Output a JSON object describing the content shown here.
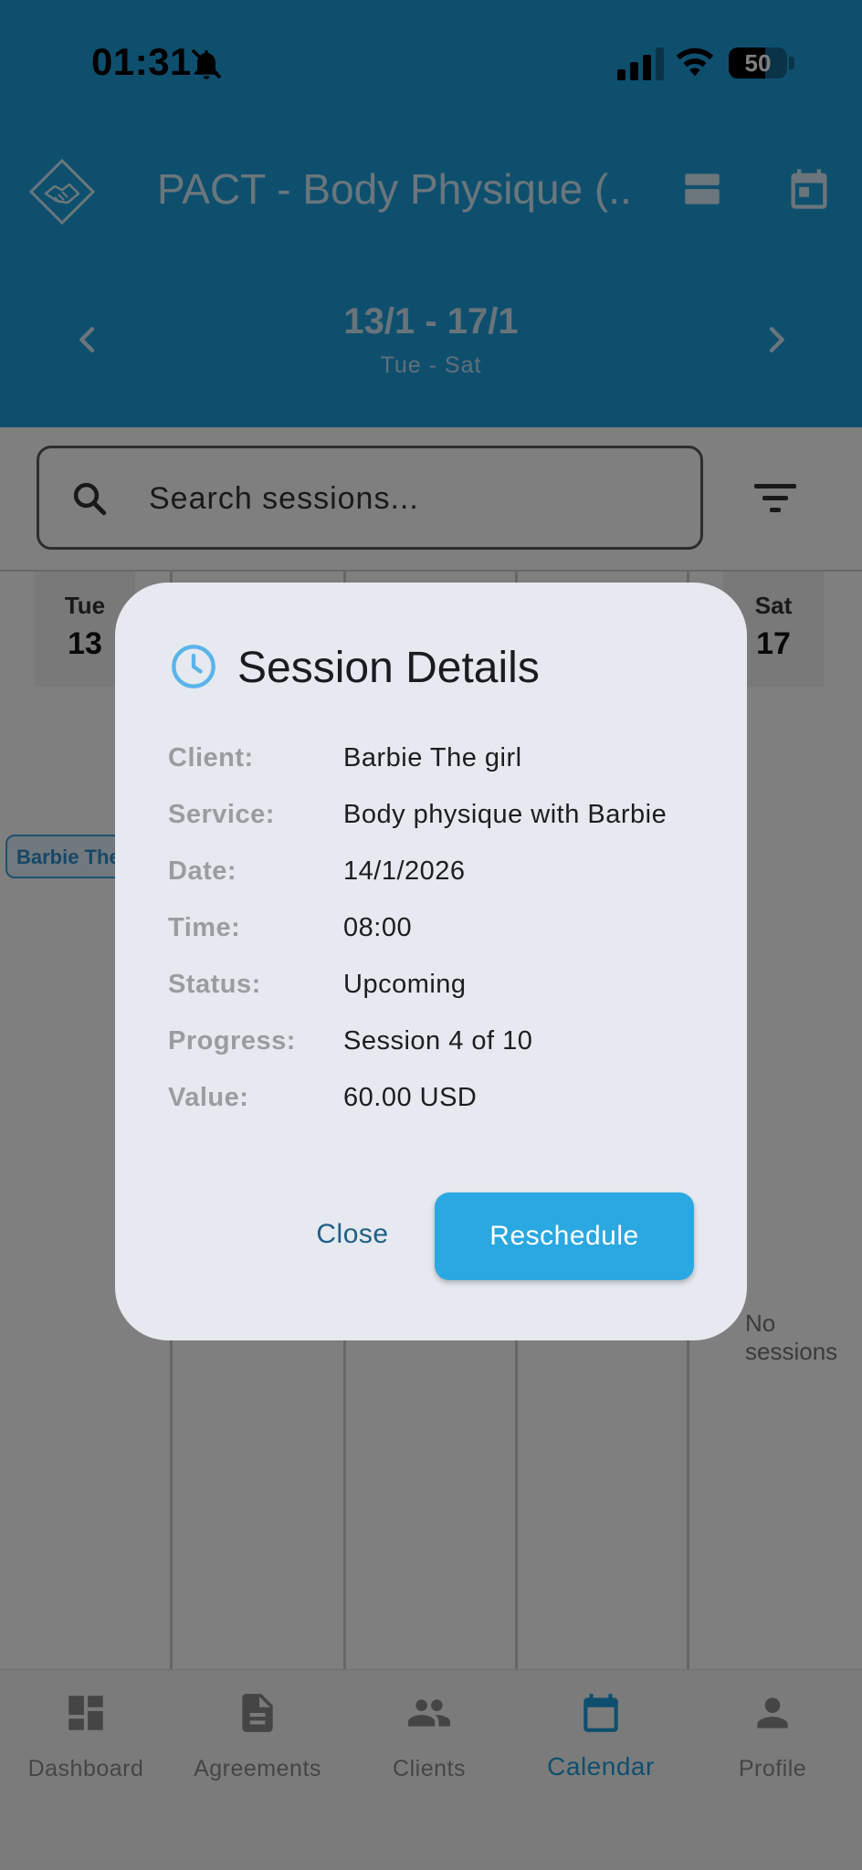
{
  "status_bar": {
    "time": "01:31",
    "battery": "50",
    "icons": [
      "bell-slash-icon",
      "cellular-signal-icon",
      "wifi-icon",
      "battery-icon"
    ]
  },
  "app_bar": {
    "title": "PACT - Body Physique (...",
    "logo_icon": "handshake-logo-icon",
    "actions": [
      "view-agenda-icon",
      "calendar-icon"
    ]
  },
  "week_nav": {
    "range": "13/1 - 17/1",
    "days": "Tue - Sat"
  },
  "search": {
    "placeholder": "Search sessions...",
    "value": ""
  },
  "calendar": {
    "days": [
      {
        "name": "Tue",
        "num": "13"
      },
      {
        "name": "Sat",
        "num": "17"
      }
    ],
    "event_chip": "Barbie The girl",
    "empty_text": "No sessions"
  },
  "bottom_nav": {
    "items": [
      {
        "label": "Dashboard",
        "icon": "dashboard-icon"
      },
      {
        "label": "Agreements",
        "icon": "document-icon"
      },
      {
        "label": "Clients",
        "icon": "people-icon"
      },
      {
        "label": "Calendar",
        "icon": "calendar-icon"
      },
      {
        "label": "Profile",
        "icon": "person-icon"
      }
    ],
    "active": "Calendar"
  },
  "dialog": {
    "title": "Session Details",
    "icon": "clock-icon",
    "rows": [
      {
        "label": "Client:",
        "value": "Barbie The girl"
      },
      {
        "label": "Service:",
        "value": "Body physique with Barbie"
      },
      {
        "label": "Date:",
        "value": "14/1/2026"
      },
      {
        "label": "Time:",
        "value": "08:00"
      },
      {
        "label": "Status:",
        "value": "Upcoming"
      },
      {
        "label": "Progress:",
        "value": "Session 4 of 10"
      },
      {
        "label": "Value:",
        "value": "60.00 USD"
      }
    ],
    "close_label": "Close",
    "reschedule_label": "Reschedule"
  },
  "colors": {
    "primary": "#1f9fdc",
    "dialog_bg": "#e6e9ef",
    "button_bg": "#2aa8e2",
    "close_text": "#1e5f86"
  }
}
